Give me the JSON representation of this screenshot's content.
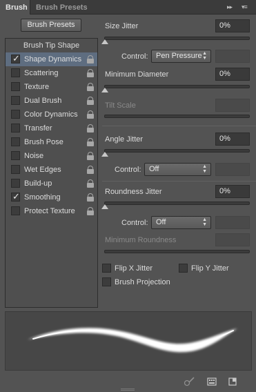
{
  "tabs": [
    {
      "label": "Brush"
    },
    {
      "label": "Brush Presets"
    }
  ],
  "panel_controls": {
    "collapse": "▸▸",
    "menu": "▾≡"
  },
  "brush_presets_button": "Brush Presets",
  "tip_shape": "Brush Tip Shape",
  "options": [
    {
      "label": "Shape Dynamics",
      "checked": true
    },
    {
      "label": "Scattering",
      "checked": false
    },
    {
      "label": "Texture",
      "checked": false
    },
    {
      "label": "Dual Brush",
      "checked": false
    },
    {
      "label": "Color Dynamics",
      "checked": false
    },
    {
      "label": "Transfer",
      "checked": false
    },
    {
      "label": "Brush Pose",
      "checked": false
    },
    {
      "label": "Noise",
      "checked": false
    },
    {
      "label": "Wet Edges",
      "checked": false
    },
    {
      "label": "Build-up",
      "checked": false
    },
    {
      "label": "Smoothing",
      "checked": true
    },
    {
      "label": "Protect Texture",
      "checked": false
    }
  ],
  "check_glyph": "✓",
  "size_jitter": {
    "label": "Size Jitter",
    "value": "0%",
    "control_label": "Control:",
    "control_value": "Pen Pressure"
  },
  "min_diameter": {
    "label": "Minimum Diameter",
    "value": "0%"
  },
  "tilt_scale": {
    "label": "Tilt Scale"
  },
  "angle_jitter": {
    "label": "Angle Jitter",
    "value": "0%",
    "control_label": "Control:",
    "control_value": "Off"
  },
  "roundness_jitter": {
    "label": "Roundness Jitter",
    "value": "0%",
    "control_label": "Control:",
    "control_value": "Off"
  },
  "min_roundness": {
    "label": "Minimum Roundness"
  },
  "flip_x": {
    "label": "Flip X Jitter",
    "checked": false
  },
  "flip_y": {
    "label": "Flip Y Jitter",
    "checked": false
  },
  "brush_projection": {
    "label": "Brush Projection",
    "checked": false
  },
  "bottom_icons": [
    "brush-toggle-icon",
    "grid-icon",
    "new-preset-icon"
  ]
}
